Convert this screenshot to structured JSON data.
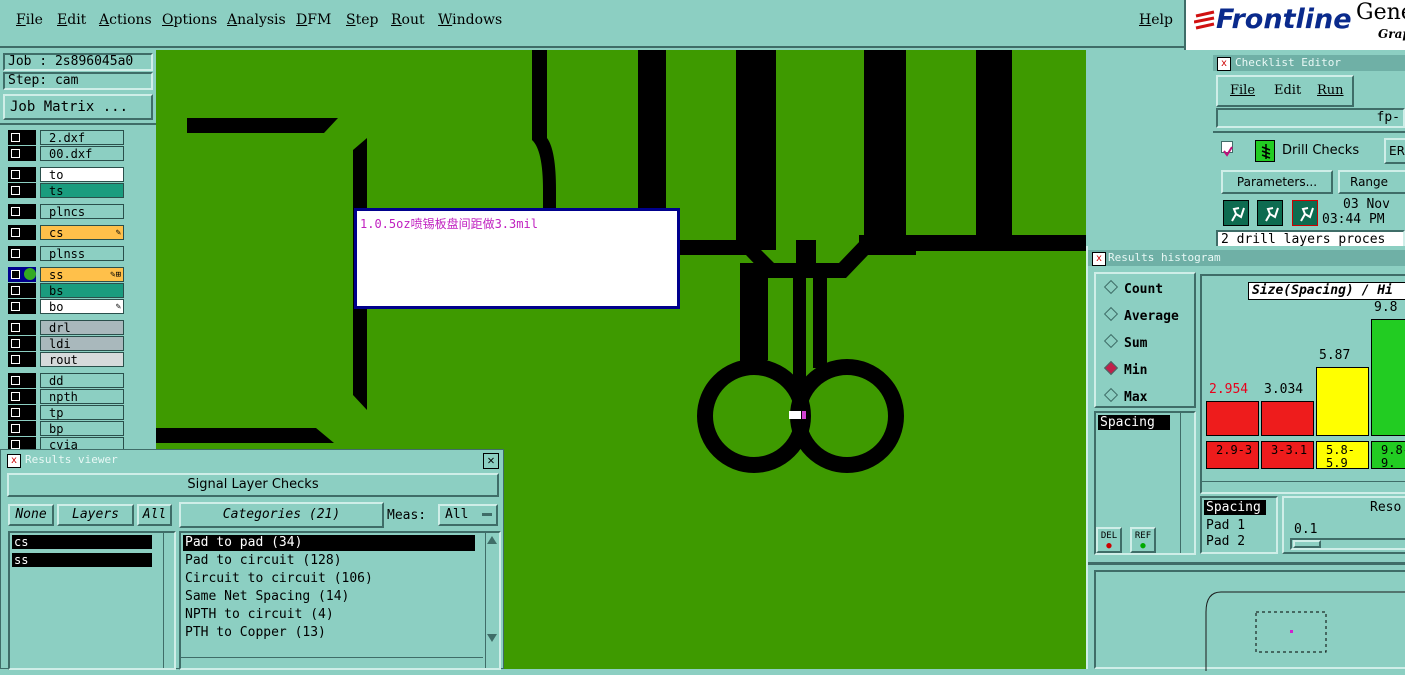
{
  "menu": [
    "File",
    "Edit",
    "Actions",
    "Options",
    "Analysis",
    "DFM",
    "Step",
    "Rout",
    "Windows"
  ],
  "help": "Help",
  "brand": {
    "name": "Frontline",
    "suffix": "Gene",
    "sub": "Grap"
  },
  "job": {
    "job_label": "Job : 2s896045a0",
    "step_label": "Step: cam",
    "matrix_button": "Job Matrix ..."
  },
  "layers": [
    {
      "name": "2.dxf",
      "color": "#8ccfc2",
      "mark": ""
    },
    {
      "name": "00.dxf",
      "color": "#8ccfc2",
      "mark": ""
    },
    {
      "name": "to",
      "color": "#ffffff",
      "mark": ""
    },
    {
      "name": "ts",
      "color": "#1a9c7e",
      "mark": ""
    },
    {
      "name": "plncs",
      "color": "#8ccfc2",
      "mark": ""
    },
    {
      "name": "cs",
      "color": "#ffc04a",
      "mark": "✎"
    },
    {
      "name": "plnss",
      "color": "#8ccfc2",
      "mark": ""
    },
    {
      "name": "ss",
      "color": "#ffc04a",
      "mark": "✎⊞"
    },
    {
      "name": "bs",
      "color": "#1a9c7e",
      "mark": ""
    },
    {
      "name": "bo",
      "color": "#ffffff",
      "mark": "✎"
    },
    {
      "name": "drl",
      "color": "#a9b8bc",
      "mark": ""
    },
    {
      "name": "ldi",
      "color": "#a9b8bc",
      "mark": ""
    },
    {
      "name": "rout",
      "color": "#d6dadb",
      "mark": ""
    },
    {
      "name": "dd",
      "color": "#8ccfc2",
      "mark": ""
    },
    {
      "name": "npth",
      "color": "#8ccfc2",
      "mark": ""
    },
    {
      "name": "tp",
      "color": "#8ccfc2",
      "mark": ""
    },
    {
      "name": "bp",
      "color": "#8ccfc2",
      "mark": ""
    },
    {
      "name": "cvia",
      "color": "#8ccfc2",
      "mark": ""
    }
  ],
  "annotation": "1.0.5oz喷锡板盘间距做3.3mil",
  "results_viewer": {
    "title": "Results viewer",
    "close": "✕",
    "heading": "Signal Layer Checks",
    "none_btn": "None",
    "layers_btn": "Layers",
    "all_btn": "All",
    "layers": [
      "cs",
      "ss"
    ],
    "categories_btn": "Categories (21)",
    "meas_label": "Meas:",
    "meas_value": "All",
    "categories": [
      "Pad to pad (34)",
      "Pad to circuit (128)",
      "Circuit to circuit (106)",
      "Same Net Spacing (14)",
      "NPTH to circuit (4)",
      "PTH to Copper (13)"
    ]
  },
  "checklist": {
    "title": "Checklist Editor",
    "menu": [
      "File",
      "Edit",
      "Run"
    ],
    "name_field": "fp-",
    "check_name": "Drill Checks",
    "erf_btn": "ER",
    "params_btn": "Parameters...",
    "range_btn": "Range",
    "date": "03 Nov",
    "time": "03:44 PM",
    "status": "2 drill layers proces"
  },
  "histogram": {
    "title": "Results histogram",
    "options": [
      "Count",
      "Average",
      "Sum",
      "Min",
      "Max"
    ],
    "selected": "Min",
    "spacing_list": [
      "Spacing"
    ],
    "del_btn": "DEL",
    "ref_btn": "REF",
    "header": "Size(Spacing) / Hi",
    "bars": [
      {
        "value": "2.954",
        "range": "2.9-3",
        "color": "#ee1c1c",
        "valcolor": "#e8001c",
        "height": 0.23
      },
      {
        "value": "3.034",
        "range": "3-3.1",
        "color": "#ee1c1c",
        "valcolor": "#000000",
        "height": 0.23
      },
      {
        "value": "5.87",
        "range": "5.8-5.9",
        "color": "#ffff00",
        "valcolor": "#000000",
        "height": 0.46
      },
      {
        "value": "9.8",
        "range": "9.8-9.",
        "color": "#22cc22",
        "valcolor": "#000000",
        "height": 0.78
      }
    ],
    "measure_list": [
      "Spacing",
      "Pad 1",
      "Pad 2"
    ],
    "reso_label": "Reso",
    "reso_value": "0.1"
  },
  "colors": {
    "panel": "#8ccfc2",
    "canvas": "#3e9a00",
    "trace": "#000000",
    "navy": "#00008c"
  }
}
